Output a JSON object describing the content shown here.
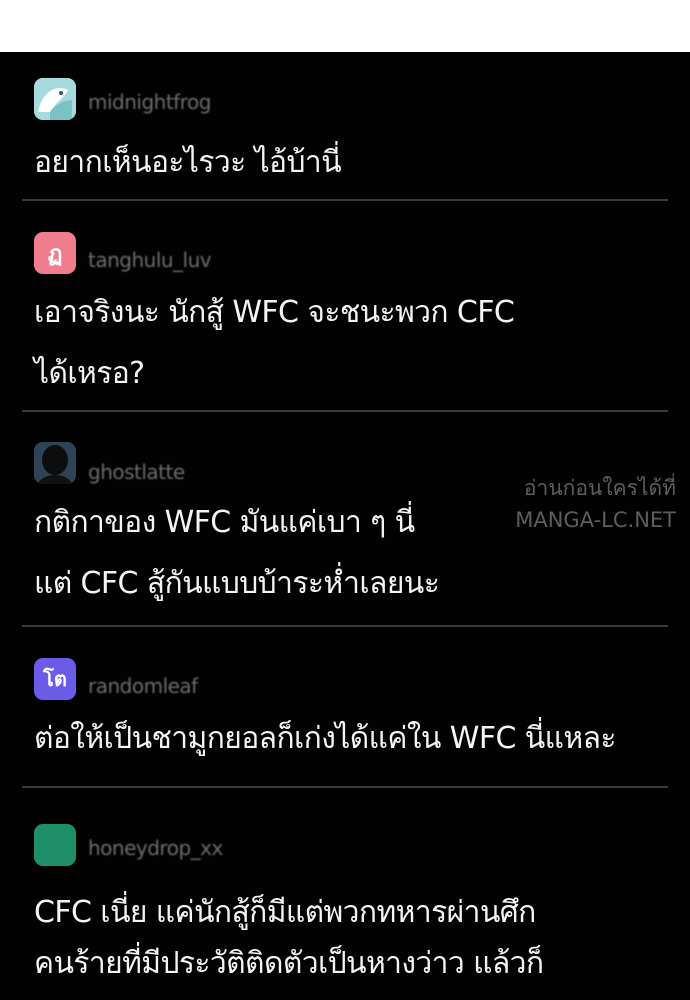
{
  "comments": [
    {
      "username": "midnightfrog",
      "avatar_color": "#9fd3d6",
      "lines": [
        "อยากเห็นอะไรวะ ไอ้บ้านี่"
      ]
    },
    {
      "username": "tanghulu_luv",
      "avatar_color": "#f07d8d",
      "avatar_glyph": "ฏ",
      "lines": [
        "เอาจริงนะ นักสู้ WFC จะชนะพวก CFC",
        "ได้เหรอ?"
      ]
    },
    {
      "username": "ghostlatte",
      "avatar_color": "#2a3a4a",
      "lines": [
        "กติกาของ WFC มันแค่เบา ๆ นี่",
        "แต่ CFC สู้กันแบบบ้าระห่ำเลยนะ"
      ]
    },
    {
      "username": "randomleaf",
      "avatar_color": "#6b5ce7",
      "avatar_glyph": "โต",
      "lines": [
        "ต่อให้เป็นชามูกยอลก็เก่งได้แค่ใน WFC นี่แหละ"
      ]
    },
    {
      "username": "honeydrop_xx",
      "avatar_color": "#1f8f6a",
      "lines": [
        "CFC เนี่ย แค่นักสู้ก็มีแต่พวกทหารผ่านศึก",
        "คนร้ายที่มีประวัติติดตัวเป็นหางว่าว แล้วก็"
      ]
    }
  ],
  "watermark": {
    "line1": "อ่านก่อนใครได้ที่",
    "line2": "MANGA-LC.NET"
  }
}
